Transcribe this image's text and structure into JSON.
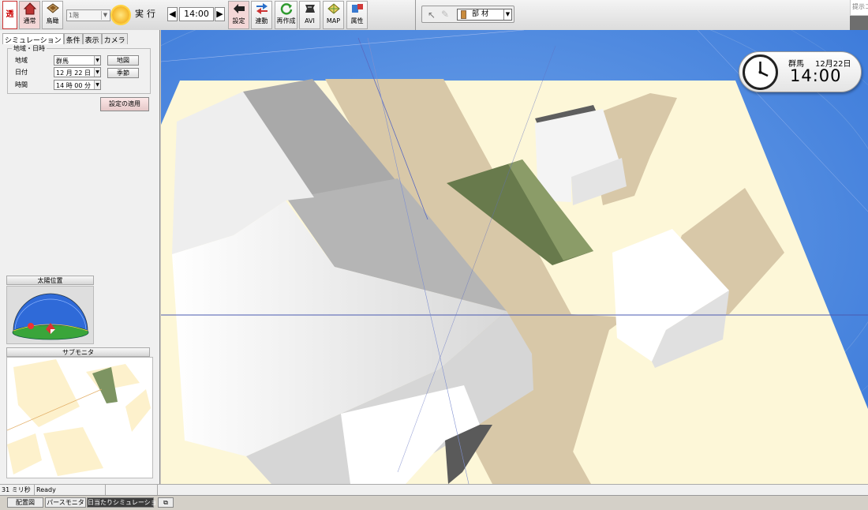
{
  "toolbar": {
    "toru_label": "透",
    "tsujo_label": "通常",
    "fukan_label": "鳥瞰",
    "floor_value": "1階",
    "run_label": "実行",
    "time_value": "14:00",
    "settei_label": "設定",
    "rendo_label": "連動",
    "saisaku_label": "再作成",
    "avi_label": "AVI",
    "map_label": "MAP",
    "zokusei_label": "属性",
    "part_value": "部材",
    "search_placeholder": "提示コ"
  },
  "left_panel": {
    "tabs": [
      {
        "label": "シミュレーション"
      },
      {
        "label": "条件"
      },
      {
        "label": "表示"
      },
      {
        "label": "カメラ"
      }
    ],
    "group_title": "地域・日時",
    "region": {
      "label": "地域",
      "value": "群馬"
    },
    "date": {
      "label": "日付",
      "value": "12 月 22 日"
    },
    "time": {
      "label": "時間",
      "value": "14 時 00 分"
    },
    "map_button": "地図",
    "season_button": "季節",
    "apply_button": "設定の適用",
    "sun_position_title": "太陽位置",
    "sub_monitor_title": "サブモニタ"
  },
  "clock": {
    "place": "群馬",
    "date": "12月22日",
    "time": "14:00"
  },
  "status": {
    "elapsed": "31 ミリ秒",
    "state": "Ready"
  },
  "bottom_tabs": [
    {
      "label": "配置図"
    },
    {
      "label": "パースモニタ"
    },
    {
      "label": "日当たりシミュレーション"
    }
  ],
  "colors": {
    "sky": "#3b7bd6",
    "ground": "#fdf7d8",
    "shadow": "#d8c8a8",
    "tree": "#687a4c"
  }
}
